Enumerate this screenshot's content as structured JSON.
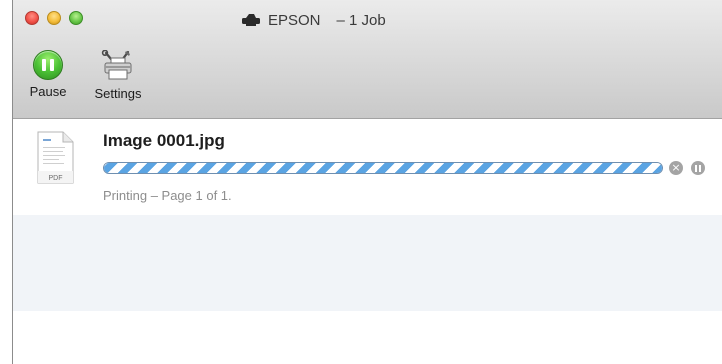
{
  "window": {
    "title_printer": "EPSON",
    "title_jobs": "– 1 Job",
    "title_icon": "printer-icon"
  },
  "toolbar": {
    "pause_label": "Pause",
    "pause_icon": "pause-icon",
    "settings_label": "Settings",
    "settings_icon": "printer-settings-icon"
  },
  "jobs": [
    {
      "name": "Image 0001.jpg",
      "icon": "pdf-document-icon",
      "icon_label": "PDF",
      "status": "Printing – Page 1 of 1.",
      "progress": "indeterminate",
      "accent_color": "#5aa4e3"
    }
  ]
}
